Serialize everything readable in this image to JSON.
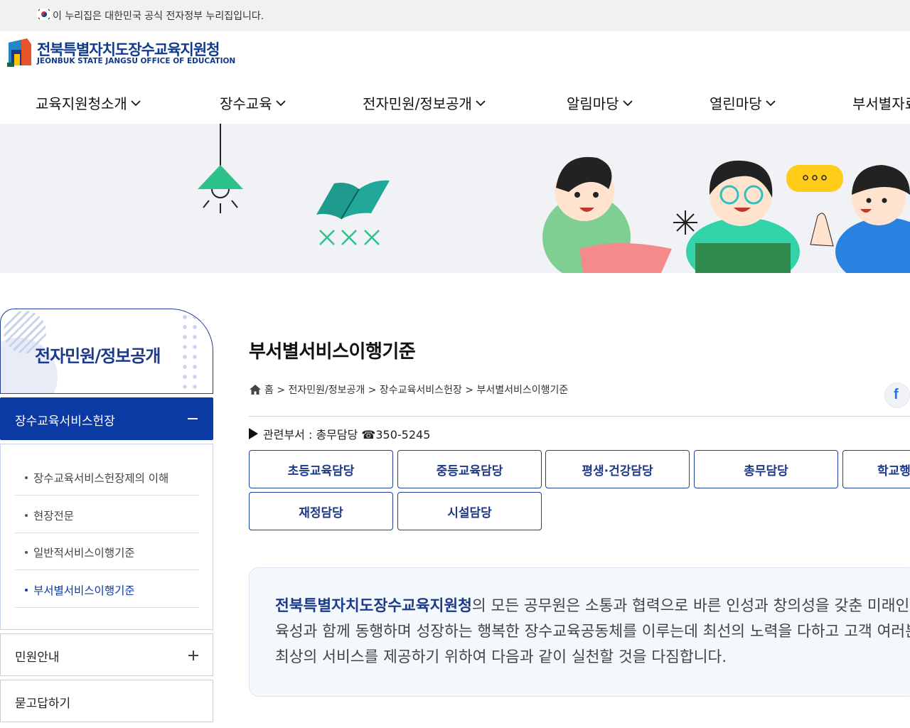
{
  "topbar": {
    "notice": "이 누리집은 대한민국 공식 전자정부 누리집입니다."
  },
  "logo": {
    "name": "전북특별자치도장수교육지원청",
    "english": "JEONBUK STATE JANGSU OFFICE OF EDUCATION"
  },
  "gnb": [
    "교육지원청소개",
    "장수교육",
    "전자민원/정보공개",
    "알림마당",
    "열린마당",
    "부서별자료"
  ],
  "lnb": {
    "title": "전자민원/정보공개",
    "active": "장수교육서비스헌장",
    "subs": [
      "장수교육서비스헌장제의 이해",
      "현장전문",
      "일반적서비스이행기준",
      "부서별서비스이행기준"
    ],
    "others": [
      "민원안내",
      "묻고답하기"
    ]
  },
  "page": {
    "title": "부서별서비스이행기준",
    "breadcrumb": "홈 > 전자민원/정보공개 > 장수교육서비스헌장 > 부서별서비스이행기준",
    "facebook": "f",
    "dept_label": "관련부서 : 총무담당 ☎350-5245",
    "tabs": [
      "초등교육담당",
      "중등교육담당",
      "평생·건강담당",
      "총무담당",
      "학교행정지원과",
      "재정담당",
      "시설담당"
    ],
    "intro_org": "전북특별자치도장수교육지원청",
    "intro_line1": "의 모든 공무원은 소통과 협력으로 바른 인성과 창의성을 갖춘 미래인재",
    "intro_line2": "육성과 함께 동행하며 성장하는 행복한 장수교육공동체를 이루는데 최선의 노력을 다하고 고객 여러분께",
    "intro_line3": "최상의 서비스를 제공하기 위하여 다음과 같이 실천할 것을 다짐합니다."
  },
  "colors": {
    "primary": "#0b3aa5",
    "accent_text": "#1d3a8a",
    "hero_bg": "#f1f2f6"
  }
}
